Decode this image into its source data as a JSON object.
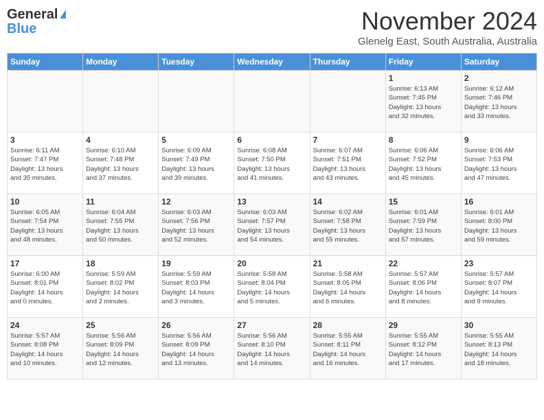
{
  "header": {
    "logo_general": "General",
    "logo_blue": "Blue",
    "month": "November 2024",
    "location": "Glenelg East, South Australia, Australia"
  },
  "days_of_week": [
    "Sunday",
    "Monday",
    "Tuesday",
    "Wednesday",
    "Thursday",
    "Friday",
    "Saturday"
  ],
  "weeks": [
    [
      {
        "day": "",
        "info": ""
      },
      {
        "day": "",
        "info": ""
      },
      {
        "day": "",
        "info": ""
      },
      {
        "day": "",
        "info": ""
      },
      {
        "day": "",
        "info": ""
      },
      {
        "day": "1",
        "info": "Sunrise: 6:13 AM\nSunset: 7:45 PM\nDaylight: 13 hours\nand 32 minutes."
      },
      {
        "day": "2",
        "info": "Sunrise: 6:12 AM\nSunset: 7:46 PM\nDaylight: 13 hours\nand 33 minutes."
      }
    ],
    [
      {
        "day": "3",
        "info": "Sunrise: 6:11 AM\nSunset: 7:47 PM\nDaylight: 13 hours\nand 35 minutes."
      },
      {
        "day": "4",
        "info": "Sunrise: 6:10 AM\nSunset: 7:48 PM\nDaylight: 13 hours\nand 37 minutes."
      },
      {
        "day": "5",
        "info": "Sunrise: 6:09 AM\nSunset: 7:49 PM\nDaylight: 13 hours\nand 39 minutes."
      },
      {
        "day": "6",
        "info": "Sunrise: 6:08 AM\nSunset: 7:50 PM\nDaylight: 13 hours\nand 41 minutes."
      },
      {
        "day": "7",
        "info": "Sunrise: 6:07 AM\nSunset: 7:51 PM\nDaylight: 13 hours\nand 43 minutes."
      },
      {
        "day": "8",
        "info": "Sunrise: 6:06 AM\nSunset: 7:52 PM\nDaylight: 13 hours\nand 45 minutes."
      },
      {
        "day": "9",
        "info": "Sunrise: 6:06 AM\nSunset: 7:53 PM\nDaylight: 13 hours\nand 47 minutes."
      }
    ],
    [
      {
        "day": "10",
        "info": "Sunrise: 6:05 AM\nSunset: 7:54 PM\nDaylight: 13 hours\nand 48 minutes."
      },
      {
        "day": "11",
        "info": "Sunrise: 6:04 AM\nSunset: 7:55 PM\nDaylight: 13 hours\nand 50 minutes."
      },
      {
        "day": "12",
        "info": "Sunrise: 6:03 AM\nSunset: 7:56 PM\nDaylight: 13 hours\nand 52 minutes."
      },
      {
        "day": "13",
        "info": "Sunrise: 6:03 AM\nSunset: 7:57 PM\nDaylight: 13 hours\nand 54 minutes."
      },
      {
        "day": "14",
        "info": "Sunrise: 6:02 AM\nSunset: 7:58 PM\nDaylight: 13 hours\nand 55 minutes."
      },
      {
        "day": "15",
        "info": "Sunrise: 6:01 AM\nSunset: 7:59 PM\nDaylight: 13 hours\nand 57 minutes."
      },
      {
        "day": "16",
        "info": "Sunrise: 6:01 AM\nSunset: 8:00 PM\nDaylight: 13 hours\nand 59 minutes."
      }
    ],
    [
      {
        "day": "17",
        "info": "Sunrise: 6:00 AM\nSunset: 8:01 PM\nDaylight: 14 hours\nand 0 minutes."
      },
      {
        "day": "18",
        "info": "Sunrise: 5:59 AM\nSunset: 8:02 PM\nDaylight: 14 hours\nand 2 minutes."
      },
      {
        "day": "19",
        "info": "Sunrise: 5:59 AM\nSunset: 8:03 PM\nDaylight: 14 hours\nand 3 minutes."
      },
      {
        "day": "20",
        "info": "Sunrise: 5:58 AM\nSunset: 8:04 PM\nDaylight: 14 hours\nand 5 minutes."
      },
      {
        "day": "21",
        "info": "Sunrise: 5:58 AM\nSunset: 8:05 PM\nDaylight: 14 hours\nand 6 minutes."
      },
      {
        "day": "22",
        "info": "Sunrise: 5:57 AM\nSunset: 8:06 PM\nDaylight: 14 hours\nand 8 minutes."
      },
      {
        "day": "23",
        "info": "Sunrise: 5:57 AM\nSunset: 8:07 PM\nDaylight: 14 hours\nand 9 minutes."
      }
    ],
    [
      {
        "day": "24",
        "info": "Sunrise: 5:57 AM\nSunset: 8:08 PM\nDaylight: 14 hours\nand 10 minutes."
      },
      {
        "day": "25",
        "info": "Sunrise: 5:56 AM\nSunset: 8:09 PM\nDaylight: 14 hours\nand 12 minutes."
      },
      {
        "day": "26",
        "info": "Sunrise: 5:56 AM\nSunset: 8:09 PM\nDaylight: 14 hours\nand 13 minutes."
      },
      {
        "day": "27",
        "info": "Sunrise: 5:56 AM\nSunset: 8:10 PM\nDaylight: 14 hours\nand 14 minutes."
      },
      {
        "day": "28",
        "info": "Sunrise: 5:55 AM\nSunset: 8:11 PM\nDaylight: 14 hours\nand 16 minutes."
      },
      {
        "day": "29",
        "info": "Sunrise: 5:55 AM\nSunset: 8:12 PM\nDaylight: 14 hours\nand 17 minutes."
      },
      {
        "day": "30",
        "info": "Sunrise: 5:55 AM\nSunset: 8:13 PM\nDaylight: 14 hours\nand 18 minutes."
      }
    ]
  ]
}
